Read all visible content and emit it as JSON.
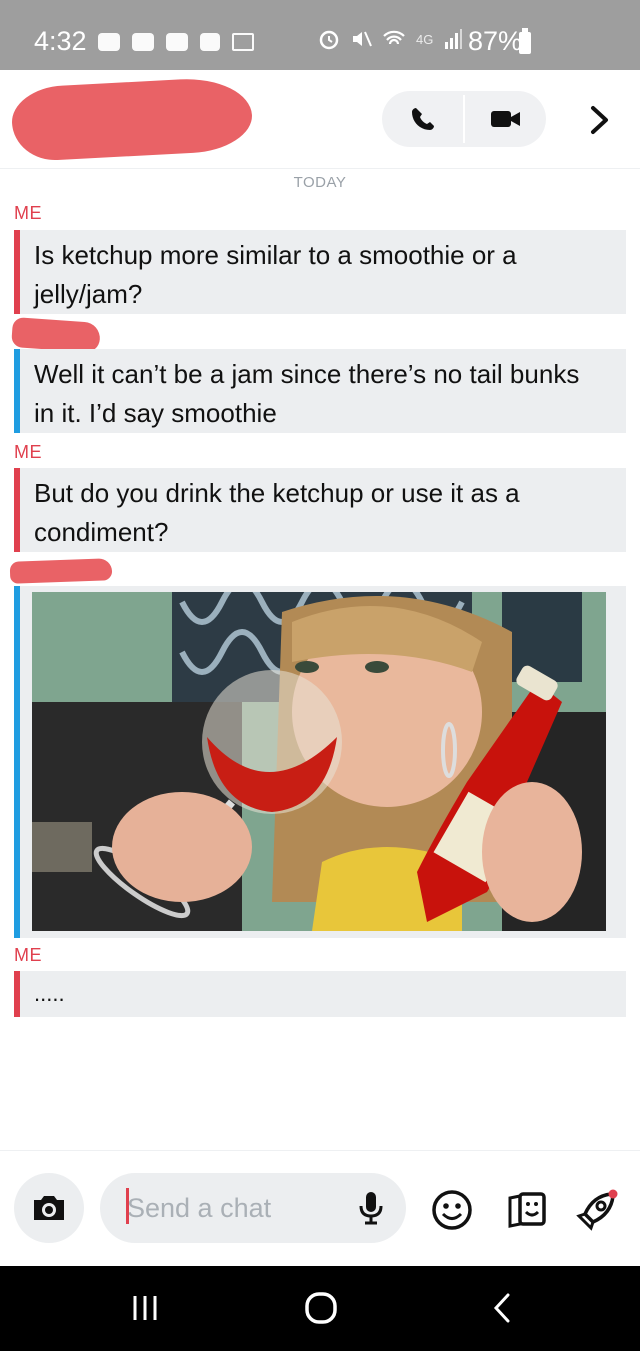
{
  "status_bar": {
    "time": "4:32",
    "battery_percent": "87%",
    "network": "4G",
    "icons_left": [
      "notification-icon",
      "notification-icon",
      "notification-icon",
      "video-app-icon",
      "calendar-icon"
    ],
    "icons_right": [
      "alarm-icon",
      "mute-icon",
      "wifi-icon",
      "signal-icon",
      "battery-icon"
    ]
  },
  "header": {
    "contact_name_redacted": true,
    "call_icon": "phone-icon",
    "video_icon": "video-camera-icon",
    "more_icon": "chevron-right-icon"
  },
  "conversation": {
    "date_label": "TODAY",
    "messages": [
      {
        "sender": "ME",
        "text": "Is ketchup more similar to a smoothie or a jelly/jam?",
        "accent": "#e0404e"
      },
      {
        "sender": "",
        "sender_redacted": true,
        "text": "Well it can’t be a jam since there’s no tail bunks in it. I’d say smoothie",
        "accent": "#1f9de1"
      },
      {
        "sender": "ME",
        "text": "But do you drink the ketchup or use it as a condiment?",
        "accent": "#e0404e"
      },
      {
        "sender": "",
        "sender_redacted": true,
        "type": "photo",
        "accent": "#1f9de1"
      },
      {
        "sender": "ME",
        "text": ".....",
        "accent": "#e0404e"
      }
    ]
  },
  "bottom_bar": {
    "input_placeholder": "Send a chat",
    "camera_icon": "camera-icon",
    "mic_icon": "microphone-icon",
    "tools": [
      "smiley-icon",
      "stickers-icon",
      "rocket-icon"
    ]
  },
  "colors": {
    "me_accent": "#e0404e",
    "friend_accent": "#1f9de1",
    "bubble_bg": "#eceef0",
    "redaction": "#e96266"
  }
}
